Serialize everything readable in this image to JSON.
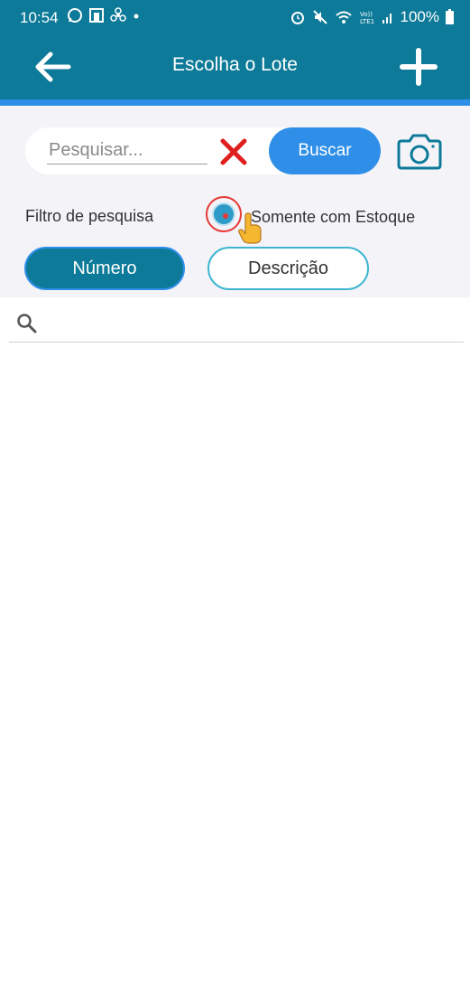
{
  "status_bar": {
    "time": "10:54",
    "battery": "100%",
    "icons": [
      "whatsapp-icon",
      "app-icon",
      "fan-icon",
      "dot-icon",
      "alarm-icon",
      "mute-icon",
      "wifi-icon",
      "volte-icon",
      "signal-icon",
      "battery-icon"
    ]
  },
  "app_bar": {
    "title": "Escolha o Lote",
    "back_icon": "arrow-left-icon",
    "add_icon": "plus-icon",
    "color": "#0c7a98",
    "accent": "#2f8fe8"
  },
  "search": {
    "placeholder": "Pesquisar...",
    "value": "",
    "clear_icon": "close-x-icon",
    "button_label": "Buscar",
    "camera_icon": "camera-icon"
  },
  "filter": {
    "label": "Filtro de pesquisa",
    "checkbox_label": "Somente com Estoque",
    "checked": true
  },
  "segments": {
    "items": [
      {
        "label": "Número",
        "selected": true
      },
      {
        "label": "Descrição",
        "selected": false
      }
    ]
  },
  "list": {
    "search_icon": "magnifier-icon",
    "items": []
  }
}
